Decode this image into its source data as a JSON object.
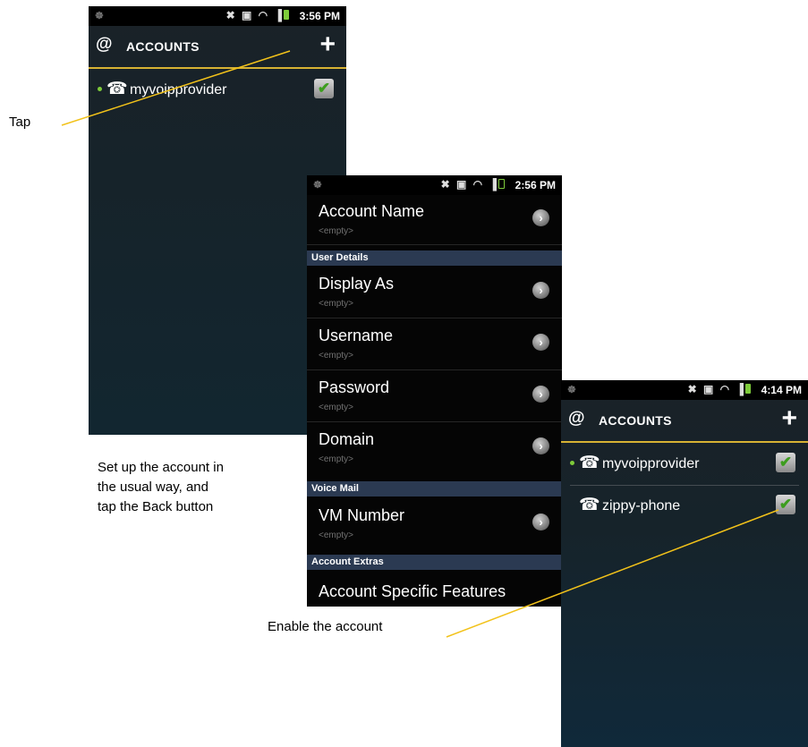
{
  "screen1": {
    "status": {
      "time": "3:56 PM",
      "left_icon": "☸"
    },
    "title": "ACCOUNTS",
    "accounts": [
      {
        "name": "myvoipprovider",
        "enabled": true,
        "online": true
      }
    ]
  },
  "screen2": {
    "status": {
      "time": "2:56 PM",
      "left_icon": "☸"
    },
    "fields": {
      "account_name": {
        "label": "Account Name",
        "value": "<empty>"
      },
      "display_as": {
        "label": "Display As",
        "value": "<empty>"
      },
      "username": {
        "label": "Username",
        "value": "<empty>"
      },
      "password": {
        "label": "Password",
        "value": "<empty>"
      },
      "domain": {
        "label": "Domain",
        "value": "<empty>"
      },
      "vm_number": {
        "label": "VM Number",
        "value": "<empty>"
      },
      "account_specific": {
        "label": "Account Specific Features"
      }
    },
    "sections": {
      "user_details": "User Details",
      "voice_mail": "Voice Mail",
      "account_extras": "Account Extras"
    }
  },
  "screen3": {
    "status": {
      "time": "4:14 PM",
      "left_icon": "☸"
    },
    "title": "ACCOUNTS",
    "accounts": [
      {
        "name": "myvoipprovider",
        "enabled": true,
        "online": true
      },
      {
        "name": "zippy-phone",
        "enabled": true,
        "online": false
      }
    ]
  },
  "annotations": {
    "tap": "Tap",
    "setup_line1": "Set up the account in",
    "setup_line2": "the usual way, and",
    "setup_line3": "tap the Back button",
    "enable": "Enable the account"
  },
  "colors": {
    "accent": "#d7b233",
    "online_dot": "#7ecb3a",
    "section_bg": "#2b3a52",
    "callout_line": "#f2c21a"
  },
  "icons": {
    "at": "at-icon",
    "plus": "plus-icon",
    "phone": "phone-icon",
    "check": "check-icon",
    "chevron": "chevron-right-icon"
  }
}
